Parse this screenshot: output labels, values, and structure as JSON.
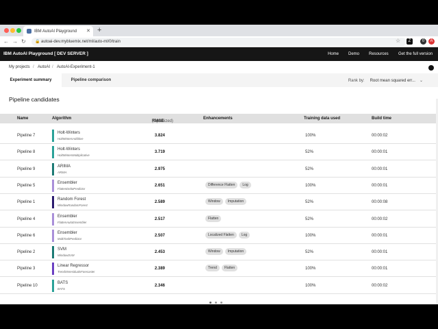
{
  "browser": {
    "tab_title": "IBM AutoAI Playground",
    "url": "autoai-dev.mybluemix.net/ml/auto-ml/0/train",
    "new_tab_label": "+",
    "extensions": [
      "Z",
      "0",
      "A"
    ]
  },
  "appbar": {
    "brand": "IBM AutoAI Playground [ DEV SERVER ]",
    "nav": [
      "Home",
      "Demo",
      "Resources",
      "Get the full version"
    ]
  },
  "breadcrumb": [
    "My projects",
    "/",
    "AutoAI",
    "/",
    "AutoAI-Experiment-1"
  ],
  "tabs": {
    "summary": "Experiment summary",
    "comparison": "Pipeline comparison",
    "rank_label": "Rank by:",
    "rank_value": "Root mean squared err..."
  },
  "section_title": "Pipeline candidates",
  "columns": {
    "name": "Name",
    "algorithm": "Algorithm",
    "rmse": "RMSE",
    "rmse_sub": "(Optimized)",
    "enhancements": "Enhancements",
    "training": "Training data used",
    "build": "Build time"
  },
  "rows": [
    {
      "name": "Pipeline 7",
      "alg": "Holt-Winters",
      "sub": "HoltWintersAdditive",
      "color": "#2aa198",
      "rmse": "3.824",
      "tags": [],
      "train": "100%",
      "time": "00:00:02"
    },
    {
      "name": "Pipeline 8",
      "alg": "Holt-Winters",
      "sub": "HoltWintersMultiplicative",
      "color": "#2aa198",
      "rmse": "3.719",
      "tags": [],
      "train": "52%",
      "time": "00:00:01"
    },
    {
      "name": "Pipeline 9",
      "alg": "ARIMA",
      "sub": "ARIMA",
      "color": "#1b7a74",
      "rmse": "2.975",
      "tags": [],
      "train": "52%",
      "time": "00:00:01"
    },
    {
      "name": "Pipeline 5",
      "alg": "Ensembler",
      "sub": "FlattenDeltaPredictor",
      "color": "#a98fd9",
      "rmse": "2.651",
      "tags": [
        "Difference Flatten",
        "Log"
      ],
      "train": "100%",
      "time": "00:00:01"
    },
    {
      "name": "Pipeline 1",
      "alg": "Random Forest",
      "sub": "WindowRandomForest",
      "color": "#2a1a6e",
      "rmse": "2.589",
      "tags": [
        "Window",
        "Imputation"
      ],
      "train": "52%",
      "time": "00:00:08"
    },
    {
      "name": "Pipeline 4",
      "alg": "Ensembler",
      "sub": "FlattenAutoEnsembler",
      "color": "#a98fd9",
      "rmse": "2.517",
      "tags": [
        "Flatten"
      ],
      "train": "52%",
      "time": "00:00:02"
    },
    {
      "name": "Pipeline 6",
      "alg": "Ensembler",
      "sub": "MultiTaskPredictor",
      "color": "#a98fd9",
      "rmse": "2.507",
      "tags": [
        "Localized Flatten",
        "Log"
      ],
      "train": "100%",
      "time": "00:00:01"
    },
    {
      "name": "Pipeline 2",
      "alg": "SVM",
      "sub": "WindowSVM",
      "color": "#1b7a74",
      "rmse": "2.453",
      "tags": [
        "Window",
        "Imputation"
      ],
      "train": "52%",
      "time": "00:00:01"
    },
    {
      "name": "Pipeline 3",
      "alg": "Linear Regressor",
      "sub": "TrendSNresidualsForecaster",
      "color": "#6a3fc2",
      "rmse": "2.389",
      "tags": [
        "Trend",
        "Flatten"
      ],
      "train": "100%",
      "time": "00:00:01"
    },
    {
      "name": "Pipeline 10",
      "alg": "BATS",
      "sub": "BATS",
      "color": "#2aa198",
      "rmse": "2.346",
      "tags": [],
      "train": "100%",
      "time": "00:00:02"
    }
  ]
}
